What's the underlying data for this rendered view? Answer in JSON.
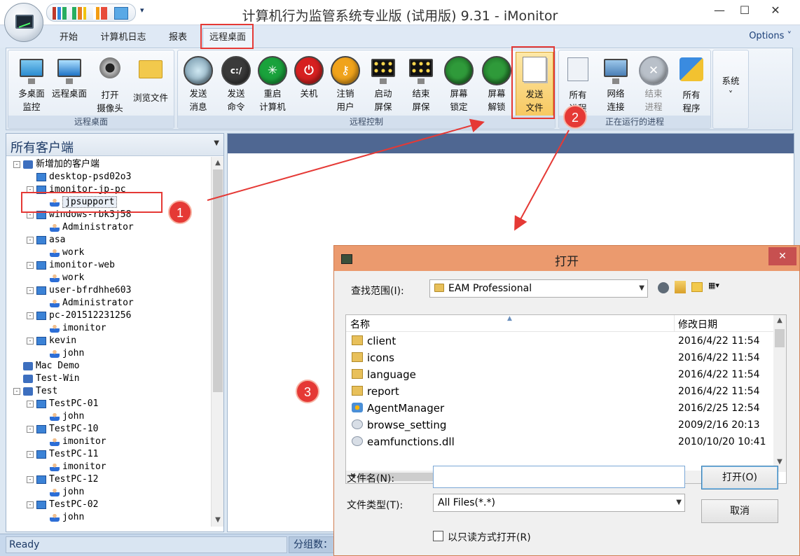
{
  "window": {
    "title": "计算机行为监管系统专业版 (试用版) 9.31 - iMonitor",
    "minimize": "—",
    "maximize": "☐",
    "close": "✕"
  },
  "tabs": [
    "开始",
    "计算机日志",
    "报表",
    "远程桌面"
  ],
  "active_tab": "远程桌面",
  "options_label": "Options ˅",
  "ribbon": {
    "group1": {
      "label": "远程桌面",
      "buttons": [
        "多桌面\n监控",
        "远程桌面",
        "打开\n摄像头",
        "浏览文件"
      ]
    },
    "group2": {
      "label": "远程控制",
      "buttons": [
        "发送\n消息",
        "发送\n命令",
        "重启\n计算机",
        "关机",
        "注销\n用户",
        "启动\n屏保",
        "结束\n屏保",
        "屏幕\n锁定",
        "屏幕\n解锁",
        "发送\n文件"
      ]
    },
    "group3": {
      "label": "正在运行的进程",
      "buttons": [
        "所有\n进程",
        "网络\n连接",
        "结束\n进程",
        "所有\n程序"
      ]
    },
    "group4": {
      "buttons": [
        "系统\n˅"
      ]
    }
  },
  "left_panel": {
    "title": "所有客户端",
    "tree": [
      "新增加的客户端",
      "desktop-psd02o3",
      "imonitor-jp-pc",
      "jpsupport",
      "windows-rbk3j58",
      "Administrator",
      "asa",
      "work",
      "imonitor-web",
      "work",
      "user-bfrdhhe603",
      "Administrator",
      "pc-201512231256",
      "imonitor",
      "kevin",
      "john",
      "Mac Demo",
      "Test-Win",
      "Test",
      "TestPC-01",
      "john",
      "TestPC-10",
      "imonitor",
      "TestPC-11",
      "imonitor",
      "TestPC-12",
      "john",
      "TestPC-02",
      "john"
    ]
  },
  "status": {
    "left": "Ready",
    "right": "分组数："
  },
  "dialog": {
    "title": "打开",
    "close": "✕",
    "look_in_label": "查找范围(I):",
    "look_in_value": "EAM Professional",
    "columns": {
      "name": "名称",
      "date": "修改日期"
    },
    "files": [
      {
        "name": "client",
        "date": "2016/4/22 11:54",
        "type": "folder"
      },
      {
        "name": "icons",
        "date": "2016/4/22 11:54",
        "type": "folder"
      },
      {
        "name": "language",
        "date": "2016/4/22 11:54",
        "type": "folder"
      },
      {
        "name": "report",
        "date": "2016/4/22 11:54",
        "type": "folder"
      },
      {
        "name": "AgentManager",
        "date": "2016/2/25 12:54",
        "type": "exe"
      },
      {
        "name": "browse_setting",
        "date": "2009/2/16 20:13",
        "type": "cfg"
      },
      {
        "name": "eamfunctions.dll",
        "date": "2010/10/20 10:41",
        "type": "cfg"
      }
    ],
    "filename_label": "文件名(N):",
    "filename_value": "",
    "filetype_label": "文件类型(T):",
    "filetype_value": "All Files(*.*)",
    "open_button": "打开(O)",
    "cancel_button": "取消",
    "readonly_label": "以只读方式打开(R)"
  },
  "annotations": [
    "1",
    "2",
    "3"
  ],
  "colors": {
    "annotation": "#e53935",
    "dialog_title": "#eb9a6e",
    "panel_header": "#4f6792"
  }
}
